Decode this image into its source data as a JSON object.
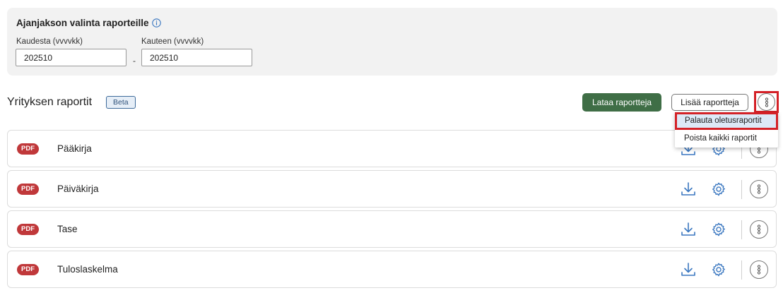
{
  "period": {
    "title": "Ajanjakson valinta raporteille",
    "from_label": "Kaudesta (vvvvkk)",
    "from_value": "202510",
    "to_label": "Kauteen (vvvvkk)",
    "to_value": "202510",
    "separator": "-"
  },
  "section": {
    "title": "Yrityksen raportit",
    "badge": "Beta",
    "download_button": "Lataa raportteja",
    "add_button": "Lisää raportteja"
  },
  "dropdown": {
    "items": [
      "Palauta oletusraportit",
      "Poista kaikki raportit"
    ]
  },
  "reports": [
    {
      "type": "PDF",
      "name": "Pääkirja"
    },
    {
      "type": "PDF",
      "name": "Päiväkirja"
    },
    {
      "type": "PDF",
      "name": "Tase"
    },
    {
      "type": "PDF",
      "name": "Tuloslaskelma"
    }
  ],
  "colors": {
    "primary_button": "#3f6e46",
    "pdf_badge": "#c0383a",
    "highlight_border": "#d42127",
    "icon_blue": "#3a77c0"
  },
  "icons": {
    "info": "info-icon",
    "more": "more-vertical-icon",
    "download": "download-icon",
    "settings": "gear-icon"
  }
}
